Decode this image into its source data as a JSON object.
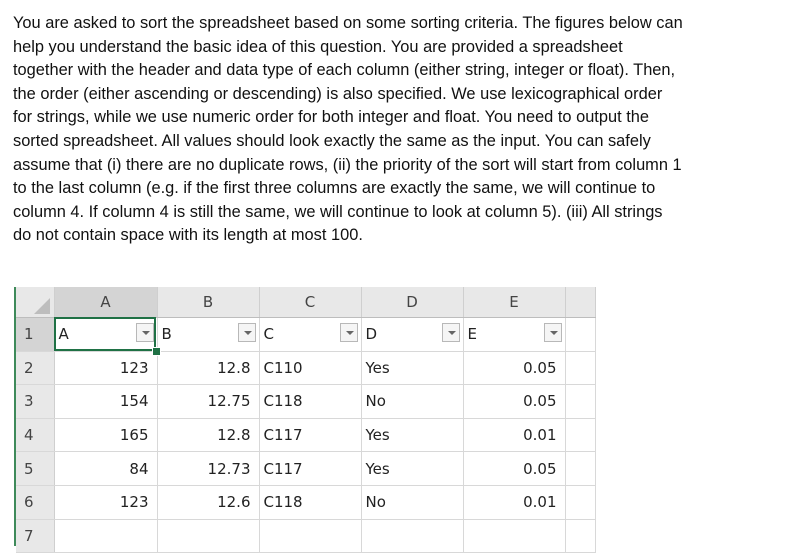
{
  "instructions": {
    "lines": [
      "You are asked to sort the spreadsheet based on some sorting criteria. The figures below can",
      "help you understand the basic idea of this question. You are provided a spreadsheet",
      "together with the header and data type of each column (either string, integer or float). Then,",
      "the order (either ascending or descending) is also specified. We use lexicographical order",
      "for strings, while we use numeric order for both integer and float. You need to output the",
      "sorted spreadsheet. All values should look exactly the same as the input. You can safely",
      "assume that (i) there are no duplicate rows, (ii) the priority of the sort will start from column 1",
      "to the last column (e.g. if the first three columns are exactly the same, we will continue to",
      "column 4. If column 4 is still the same, we will continue to look at column 5). (iii) All strings",
      "do not contain space with its length at most 100."
    ]
  },
  "spreadsheet": {
    "column_letters": [
      "A",
      "B",
      "C",
      "D",
      "E"
    ],
    "row_numbers": [
      "1",
      "2",
      "3",
      "4",
      "5",
      "6",
      "7"
    ],
    "headers": [
      "A",
      "B",
      "C",
      "D",
      "E"
    ],
    "filter_icon": "dropdown-arrow-icon",
    "active_cell": "A1",
    "rows": [
      [
        "123",
        "12.8",
        "C110",
        "Yes",
        "0.05"
      ],
      [
        "154",
        "12.75",
        "C118",
        "No",
        "0.05"
      ],
      [
        "165",
        "12.8",
        "C117",
        "Yes",
        "0.01"
      ],
      [
        "84",
        "12.73",
        "C117",
        "Yes",
        "0.05"
      ],
      [
        "123",
        "12.6",
        "C118",
        "No",
        "0.01"
      ],
      [
        "",
        "",
        "",
        "",
        ""
      ]
    ],
    "colors": {
      "selection_border": "#1f7145",
      "header_bg": "#e8e8e8",
      "gridline": "#d8d8d8"
    }
  }
}
